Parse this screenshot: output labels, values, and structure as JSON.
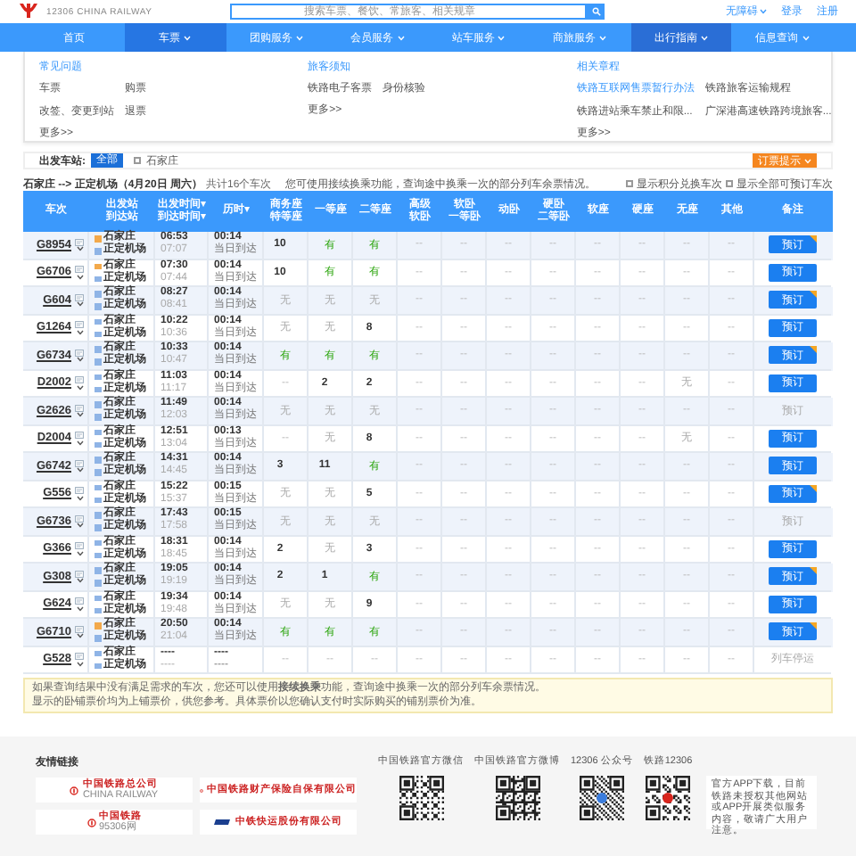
{
  "header": {
    "logo_text": "12306 CHINA RAILWAY",
    "search": {
      "placeholder": "搜索车票、餐饮、常旅客、相关规章"
    },
    "links": [
      {
        "label": "无障碍",
        "has_menu": true
      },
      {
        "label": "登录",
        "has_menu": false
      },
      {
        "label": "注册",
        "has_menu": false
      }
    ]
  },
  "nav": [
    {
      "label": "首页",
      "selected": false,
      "expanded": false,
      "has_menu": false
    },
    {
      "label": "车票",
      "selected": true,
      "expanded": false,
      "has_menu": true
    },
    {
      "label": "团购服务",
      "selected": false,
      "expanded": false,
      "has_menu": true
    },
    {
      "label": "会员服务",
      "selected": false,
      "expanded": false,
      "has_menu": true
    },
    {
      "label": "站车服务",
      "selected": false,
      "expanded": false,
      "has_menu": true
    },
    {
      "label": "商旅服务",
      "selected": false,
      "expanded": false,
      "has_menu": true
    },
    {
      "label": "出行指南",
      "selected": false,
      "expanded": true,
      "has_menu": true
    },
    {
      "label": "信息查询",
      "selected": false,
      "expanded": false,
      "has_menu": true
    }
  ],
  "dropdown": {
    "sections": [
      {
        "title": "常见问题",
        "items": [
          {
            "label": "车票",
            "highlighted": false
          },
          {
            "label": "购票",
            "highlighted": false
          },
          {
            "label": "改签、变更到站",
            "highlighted": false
          },
          {
            "label": "退票",
            "highlighted": false
          }
        ],
        "more": "更多>>"
      },
      {
        "title": "旅客须知",
        "items": [
          {
            "label": "铁路电子客票",
            "highlighted": false
          },
          {
            "label": "身份核验",
            "highlighted": false
          }
        ],
        "more": "更多>>"
      },
      {
        "title": "相关章程",
        "items": [
          {
            "label": "铁路互联网售票暂行办法",
            "highlighted": true
          },
          {
            "label": "铁路旅客运输规程",
            "highlighted": false
          },
          {
            "label": "铁路进站乘车禁止和限...",
            "highlighted": false
          },
          {
            "label": "广深港高速铁路跨境旅客...",
            "highlighted": false
          }
        ],
        "more": "更多>>"
      }
    ]
  },
  "filter": {
    "label": "出发车站:",
    "chips": [
      {
        "label": "全部",
        "selected": true
      }
    ],
    "checkboxes": [
      {
        "label": "石家庄",
        "checked": false
      }
    ],
    "tip_button": "订票提示"
  },
  "summary": {
    "route": "石家庄 --> 正定机场（4月20日 周六）",
    "count": "共计16个车次",
    "hint": "您可使用接续换乘功能，查询途中换乘一次的部分列车余票情况。",
    "options": [
      {
        "label": "显示积分兑换车次",
        "checked": false
      },
      {
        "label": "显示全部可预订车次",
        "checked": false
      }
    ]
  },
  "table": {
    "columns": [
      [
        "车次"
      ],
      [
        "出发站",
        "到达站"
      ],
      [
        "出发时间▾",
        "到达时间▾"
      ],
      [
        "历时▾"
      ],
      [
        "商务座",
        "特等座"
      ],
      [
        "一等座"
      ],
      [
        "二等座"
      ],
      [
        "高级",
        "软卧"
      ],
      [
        "软卧",
        "一等卧"
      ],
      [
        "动卧"
      ],
      [
        "硬卧",
        "二等卧"
      ],
      [
        "软座"
      ],
      [
        "硬座"
      ],
      [
        "无座"
      ],
      [
        "其他"
      ],
      [
        "备注"
      ]
    ],
    "rows": [
      {
        "code": "G8954",
        "from": {
          "name": "石家庄",
          "origin": true
        },
        "to": "正定机场",
        "depart": "06:53",
        "arrive": "07:07",
        "duration": "00:14",
        "arrival_day": "当日到达",
        "seats": [
          {
            "text": "10",
            "kind": "count"
          },
          {
            "text": "有",
            "kind": "yes"
          },
          {
            "text": "有",
            "kind": "yes"
          },
          {
            "text": "--",
            "kind": "na"
          },
          {
            "text": "--",
            "kind": "na"
          },
          {
            "text": "--",
            "kind": "na"
          },
          {
            "text": "--",
            "kind": "na"
          },
          {
            "text": "--",
            "kind": "na"
          },
          {
            "text": "--",
            "kind": "na"
          },
          {
            "text": "--",
            "kind": "na"
          },
          {
            "text": "--",
            "kind": "na"
          }
        ],
        "action": {
          "kind": "button",
          "label": "预订",
          "badge": true
        }
      },
      {
        "code": "G6706",
        "from": {
          "name": "石家庄",
          "origin": true
        },
        "to": "正定机场",
        "depart": "07:30",
        "arrive": "07:44",
        "duration": "00:14",
        "arrival_day": "当日到达",
        "seats": [
          {
            "text": "10",
            "kind": "count"
          },
          {
            "text": "有",
            "kind": "yes"
          },
          {
            "text": "有",
            "kind": "yes"
          },
          {
            "text": "--",
            "kind": "na"
          },
          {
            "text": "--",
            "kind": "na"
          },
          {
            "text": "--",
            "kind": "na"
          },
          {
            "text": "--",
            "kind": "na"
          },
          {
            "text": "--",
            "kind": "na"
          },
          {
            "text": "--",
            "kind": "na"
          },
          {
            "text": "--",
            "kind": "na"
          },
          {
            "text": "--",
            "kind": "na"
          }
        ],
        "action": {
          "kind": "button",
          "label": "预订",
          "badge": false
        }
      },
      {
        "code": "G604",
        "from": {
          "name": "石家庄",
          "origin": false
        },
        "to": "正定机场",
        "depart": "08:27",
        "arrive": "08:41",
        "duration": "00:14",
        "arrival_day": "当日到达",
        "seats": [
          {
            "text": "无",
            "kind": "none"
          },
          {
            "text": "无",
            "kind": "none"
          },
          {
            "text": "无",
            "kind": "none"
          },
          {
            "text": "--",
            "kind": "na"
          },
          {
            "text": "--",
            "kind": "na"
          },
          {
            "text": "--",
            "kind": "na"
          },
          {
            "text": "--",
            "kind": "na"
          },
          {
            "text": "--",
            "kind": "na"
          },
          {
            "text": "--",
            "kind": "na"
          },
          {
            "text": "--",
            "kind": "na"
          },
          {
            "text": "--",
            "kind": "na"
          }
        ],
        "action": {
          "kind": "button",
          "label": "预订",
          "badge": true
        }
      },
      {
        "code": "G1264",
        "from": {
          "name": "石家庄",
          "origin": false
        },
        "to": "正定机场",
        "depart": "10:22",
        "arrive": "10:36",
        "duration": "00:14",
        "arrival_day": "当日到达",
        "seats": [
          {
            "text": "无",
            "kind": "none"
          },
          {
            "text": "无",
            "kind": "none"
          },
          {
            "text": "8",
            "kind": "count"
          },
          {
            "text": "--",
            "kind": "na"
          },
          {
            "text": "--",
            "kind": "na"
          },
          {
            "text": "--",
            "kind": "na"
          },
          {
            "text": "--",
            "kind": "na"
          },
          {
            "text": "--",
            "kind": "na"
          },
          {
            "text": "--",
            "kind": "na"
          },
          {
            "text": "--",
            "kind": "na"
          },
          {
            "text": "--",
            "kind": "na"
          }
        ],
        "action": {
          "kind": "button",
          "label": "预订",
          "badge": false
        }
      },
      {
        "code": "G6734",
        "from": {
          "name": "石家庄",
          "origin": false
        },
        "to": "正定机场",
        "depart": "10:33",
        "arrive": "10:47",
        "duration": "00:14",
        "arrival_day": "当日到达",
        "seats": [
          {
            "text": "有",
            "kind": "yes"
          },
          {
            "text": "有",
            "kind": "yes"
          },
          {
            "text": "有",
            "kind": "yes"
          },
          {
            "text": "--",
            "kind": "na"
          },
          {
            "text": "--",
            "kind": "na"
          },
          {
            "text": "--",
            "kind": "na"
          },
          {
            "text": "--",
            "kind": "na"
          },
          {
            "text": "--",
            "kind": "na"
          },
          {
            "text": "--",
            "kind": "na"
          },
          {
            "text": "--",
            "kind": "na"
          },
          {
            "text": "--",
            "kind": "na"
          }
        ],
        "action": {
          "kind": "button",
          "label": "预订",
          "badge": true
        }
      },
      {
        "code": "D2002",
        "from": {
          "name": "石家庄",
          "origin": false
        },
        "to": "正定机场",
        "depart": "11:03",
        "arrive": "11:17",
        "duration": "00:14",
        "arrival_day": "当日到达",
        "seats": [
          {
            "text": "--",
            "kind": "na"
          },
          {
            "text": "2",
            "kind": "count"
          },
          {
            "text": "2",
            "kind": "count"
          },
          {
            "text": "--",
            "kind": "na"
          },
          {
            "text": "--",
            "kind": "na"
          },
          {
            "text": "--",
            "kind": "na"
          },
          {
            "text": "--",
            "kind": "na"
          },
          {
            "text": "--",
            "kind": "na"
          },
          {
            "text": "--",
            "kind": "na"
          },
          {
            "text": "无",
            "kind": "none"
          },
          {
            "text": "--",
            "kind": "na"
          }
        ],
        "action": {
          "kind": "button",
          "label": "预订",
          "badge": false
        }
      },
      {
        "code": "G2626",
        "from": {
          "name": "石家庄",
          "origin": false
        },
        "to": "正定机场",
        "depart": "11:49",
        "arrive": "12:03",
        "duration": "00:14",
        "arrival_day": "当日到达",
        "seats": [
          {
            "text": "无",
            "kind": "none"
          },
          {
            "text": "无",
            "kind": "none"
          },
          {
            "text": "无",
            "kind": "none"
          },
          {
            "text": "--",
            "kind": "na"
          },
          {
            "text": "--",
            "kind": "na"
          },
          {
            "text": "--",
            "kind": "na"
          },
          {
            "text": "--",
            "kind": "na"
          },
          {
            "text": "--",
            "kind": "na"
          },
          {
            "text": "--",
            "kind": "na"
          },
          {
            "text": "--",
            "kind": "na"
          },
          {
            "text": "--",
            "kind": "na"
          }
        ],
        "action": {
          "kind": "disabled",
          "label": "预订",
          "badge": false
        }
      },
      {
        "code": "D2004",
        "from": {
          "name": "石家庄",
          "origin": false
        },
        "to": "正定机场",
        "depart": "12:51",
        "arrive": "13:04",
        "duration": "00:13",
        "arrival_day": "当日到达",
        "seats": [
          {
            "text": "--",
            "kind": "na"
          },
          {
            "text": "无",
            "kind": "none"
          },
          {
            "text": "8",
            "kind": "count"
          },
          {
            "text": "--",
            "kind": "na"
          },
          {
            "text": "--",
            "kind": "na"
          },
          {
            "text": "--",
            "kind": "na"
          },
          {
            "text": "--",
            "kind": "na"
          },
          {
            "text": "--",
            "kind": "na"
          },
          {
            "text": "--",
            "kind": "na"
          },
          {
            "text": "无",
            "kind": "none"
          },
          {
            "text": "--",
            "kind": "na"
          }
        ],
        "action": {
          "kind": "button",
          "label": "预订",
          "badge": false
        }
      },
      {
        "code": "G6742",
        "from": {
          "name": "石家庄",
          "origin": false
        },
        "to": "正定机场",
        "depart": "14:31",
        "arrive": "14:45",
        "duration": "00:14",
        "arrival_day": "当日到达",
        "seats": [
          {
            "text": "3",
            "kind": "count"
          },
          {
            "text": "11",
            "kind": "count"
          },
          {
            "text": "有",
            "kind": "yes"
          },
          {
            "text": "--",
            "kind": "na"
          },
          {
            "text": "--",
            "kind": "na"
          },
          {
            "text": "--",
            "kind": "na"
          },
          {
            "text": "--",
            "kind": "na"
          },
          {
            "text": "--",
            "kind": "na"
          },
          {
            "text": "--",
            "kind": "na"
          },
          {
            "text": "--",
            "kind": "na"
          },
          {
            "text": "--",
            "kind": "na"
          }
        ],
        "action": {
          "kind": "button",
          "label": "预订",
          "badge": false
        }
      },
      {
        "code": "G556",
        "from": {
          "name": "石家庄",
          "origin": false
        },
        "to": "正定机场",
        "depart": "15:22",
        "arrive": "15:37",
        "duration": "00:15",
        "arrival_day": "当日到达",
        "seats": [
          {
            "text": "无",
            "kind": "none"
          },
          {
            "text": "无",
            "kind": "none"
          },
          {
            "text": "5",
            "kind": "count"
          },
          {
            "text": "--",
            "kind": "na"
          },
          {
            "text": "--",
            "kind": "na"
          },
          {
            "text": "--",
            "kind": "na"
          },
          {
            "text": "--",
            "kind": "na"
          },
          {
            "text": "--",
            "kind": "na"
          },
          {
            "text": "--",
            "kind": "na"
          },
          {
            "text": "--",
            "kind": "na"
          },
          {
            "text": "--",
            "kind": "na"
          }
        ],
        "action": {
          "kind": "button",
          "label": "预订",
          "badge": true
        }
      },
      {
        "code": "G6736",
        "from": {
          "name": "石家庄",
          "origin": false
        },
        "to": "正定机场",
        "depart": "17:43",
        "arrive": "17:58",
        "duration": "00:15",
        "arrival_day": "当日到达",
        "seats": [
          {
            "text": "无",
            "kind": "none"
          },
          {
            "text": "无",
            "kind": "none"
          },
          {
            "text": "无",
            "kind": "none"
          },
          {
            "text": "--",
            "kind": "na"
          },
          {
            "text": "--",
            "kind": "na"
          },
          {
            "text": "--",
            "kind": "na"
          },
          {
            "text": "--",
            "kind": "na"
          },
          {
            "text": "--",
            "kind": "na"
          },
          {
            "text": "--",
            "kind": "na"
          },
          {
            "text": "--",
            "kind": "na"
          },
          {
            "text": "--",
            "kind": "na"
          }
        ],
        "action": {
          "kind": "disabled",
          "label": "预订",
          "badge": false
        }
      },
      {
        "code": "G366",
        "from": {
          "name": "石家庄",
          "origin": false
        },
        "to": "正定机场",
        "depart": "18:31",
        "arrive": "18:45",
        "duration": "00:14",
        "arrival_day": "当日到达",
        "seats": [
          {
            "text": "2",
            "kind": "count"
          },
          {
            "text": "无",
            "kind": "none"
          },
          {
            "text": "3",
            "kind": "count"
          },
          {
            "text": "--",
            "kind": "na"
          },
          {
            "text": "--",
            "kind": "na"
          },
          {
            "text": "--",
            "kind": "na"
          },
          {
            "text": "--",
            "kind": "na"
          },
          {
            "text": "--",
            "kind": "na"
          },
          {
            "text": "--",
            "kind": "na"
          },
          {
            "text": "--",
            "kind": "na"
          },
          {
            "text": "--",
            "kind": "na"
          }
        ],
        "action": {
          "kind": "button",
          "label": "预订",
          "badge": false
        }
      },
      {
        "code": "G308",
        "from": {
          "name": "石家庄",
          "origin": false
        },
        "to": "正定机场",
        "depart": "19:05",
        "arrive": "19:19",
        "duration": "00:14",
        "arrival_day": "当日到达",
        "seats": [
          {
            "text": "2",
            "kind": "count"
          },
          {
            "text": "1",
            "kind": "count"
          },
          {
            "text": "有",
            "kind": "yes"
          },
          {
            "text": "--",
            "kind": "na"
          },
          {
            "text": "--",
            "kind": "na"
          },
          {
            "text": "--",
            "kind": "na"
          },
          {
            "text": "--",
            "kind": "na"
          },
          {
            "text": "--",
            "kind": "na"
          },
          {
            "text": "--",
            "kind": "na"
          },
          {
            "text": "--",
            "kind": "na"
          },
          {
            "text": "--",
            "kind": "na"
          }
        ],
        "action": {
          "kind": "button",
          "label": "预订",
          "badge": true
        }
      },
      {
        "code": "G624",
        "from": {
          "name": "石家庄",
          "origin": false
        },
        "to": "正定机场",
        "depart": "19:34",
        "arrive": "19:48",
        "duration": "00:14",
        "arrival_day": "当日到达",
        "seats": [
          {
            "text": "无",
            "kind": "none"
          },
          {
            "text": "无",
            "kind": "none"
          },
          {
            "text": "9",
            "kind": "count"
          },
          {
            "text": "--",
            "kind": "na"
          },
          {
            "text": "--",
            "kind": "na"
          },
          {
            "text": "--",
            "kind": "na"
          },
          {
            "text": "--",
            "kind": "na"
          },
          {
            "text": "--",
            "kind": "na"
          },
          {
            "text": "--",
            "kind": "na"
          },
          {
            "text": "--",
            "kind": "na"
          },
          {
            "text": "--",
            "kind": "na"
          }
        ],
        "action": {
          "kind": "button",
          "label": "预订",
          "badge": false
        }
      },
      {
        "code": "G6710",
        "from": {
          "name": "石家庄",
          "origin": true
        },
        "to": "正定机场",
        "depart": "20:50",
        "arrive": "21:04",
        "duration": "00:14",
        "arrival_day": "当日到达",
        "seats": [
          {
            "text": "有",
            "kind": "yes"
          },
          {
            "text": "有",
            "kind": "yes"
          },
          {
            "text": "有",
            "kind": "yes"
          },
          {
            "text": "--",
            "kind": "na"
          },
          {
            "text": "--",
            "kind": "na"
          },
          {
            "text": "--",
            "kind": "na"
          },
          {
            "text": "--",
            "kind": "na"
          },
          {
            "text": "--",
            "kind": "na"
          },
          {
            "text": "--",
            "kind": "na"
          },
          {
            "text": "--",
            "kind": "na"
          },
          {
            "text": "--",
            "kind": "na"
          }
        ],
        "action": {
          "kind": "button",
          "label": "预订",
          "badge": true
        }
      },
      {
        "code": "G528",
        "from": {
          "name": "石家庄",
          "origin": false
        },
        "to": "正定机场",
        "depart": "----",
        "arrive": "----",
        "duration": "----",
        "arrival_day": "----",
        "seats": [
          {
            "text": "--",
            "kind": "na"
          },
          {
            "text": "--",
            "kind": "na"
          },
          {
            "text": "--",
            "kind": "na"
          },
          {
            "text": "--",
            "kind": "na"
          },
          {
            "text": "--",
            "kind": "na"
          },
          {
            "text": "--",
            "kind": "na"
          },
          {
            "text": "--",
            "kind": "na"
          },
          {
            "text": "--",
            "kind": "na"
          },
          {
            "text": "--",
            "kind": "na"
          },
          {
            "text": "--",
            "kind": "na"
          },
          {
            "text": "--",
            "kind": "na"
          }
        ],
        "action": {
          "kind": "text",
          "label": "列车停运"
        }
      }
    ]
  },
  "notes": [
    "如果查询结果中没有满足需求的车次，您还可以使用**接续换乘**功能，查询途中换乘一次的部分列车余票情况。",
    "显示的卧铺票价均为上铺票价，供您参考。具体票价以您确认支付时实际购买的铺别票价为准。"
  ],
  "footer": {
    "links_title": "友情链接",
    "partners": [
      {
        "name": "中国铁路总公司",
        "sub": "CHINA RAILWAY",
        "kind": "emblem"
      },
      {
        "name": "中国铁路财产保险自保有限公司",
        "kind": "emblem"
      },
      {
        "name": "中国铁路",
        "sub": "95306网",
        "kind": "emblem"
      },
      {
        "name": "中铁快运股份有限公司",
        "kind": "cre"
      }
    ],
    "qr_codes": [
      {
        "label": "中国铁路官方微信",
        "kind": "plain"
      },
      {
        "label": "中国铁路官方微博",
        "kind": "plain"
      },
      {
        "label": "12306 公众号",
        "kind": "blue"
      },
      {
        "label": "铁路12306",
        "kind": "red"
      }
    ],
    "app_text": "官方APP下载，目前铁路未授权其他网站或APP开展类似服务内容，敬请广大用户注意。"
  }
}
